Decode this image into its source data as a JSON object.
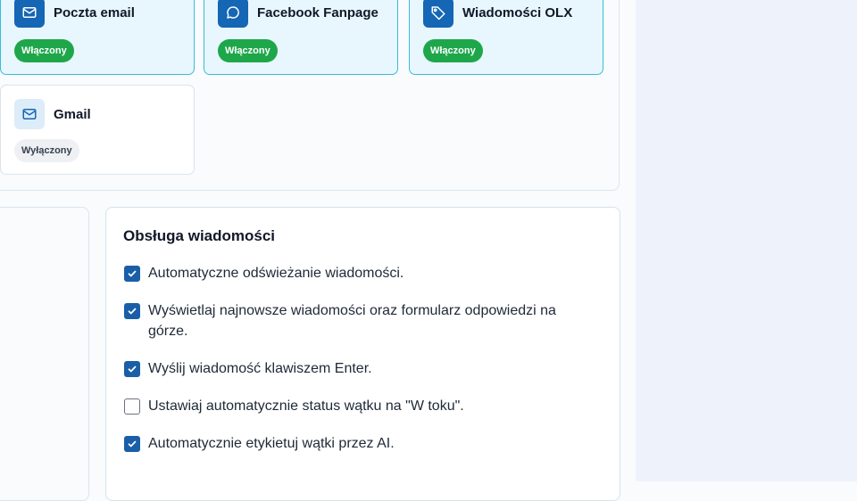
{
  "channels": [
    {
      "name": "Poczta email",
      "status": "Włączony",
      "icon": "mail-icon",
      "enabled": true
    },
    {
      "name": "Facebook Fanpage",
      "status": "Włączony",
      "icon": "chat-bubble-icon",
      "enabled": true
    },
    {
      "name": "Wiadomości OLX",
      "status": "Włączony",
      "icon": "tag-icon",
      "enabled": true
    },
    {
      "name": "Gmail",
      "status": "Wyłączony",
      "icon": "mail-icon",
      "enabled": false
    }
  ],
  "settings": {
    "title": "Obsługa wiadomości",
    "options": [
      {
        "label": "Automatyczne odświeżanie wiadomości.",
        "checked": true
      },
      {
        "label": "Wyświetlaj najnowsze wiadomości oraz formularz odpowiedzi na górze.",
        "checked": true
      },
      {
        "label": "Wyślij wiadomość klawiszem Enter.",
        "checked": true
      },
      {
        "label": "Ustawiaj automatycznie status wątku na \"W toku\".",
        "checked": false
      },
      {
        "label": "Automatycznie etykietuj wątki przez AI.",
        "checked": true
      }
    ]
  },
  "colors": {
    "accent": "#1a5ea8",
    "enabled_badge": "#1ea74a",
    "card_on_border": "#39bcd6",
    "card_on_bg": "#e7f7fd",
    "right_pane": "#eef3fb"
  }
}
